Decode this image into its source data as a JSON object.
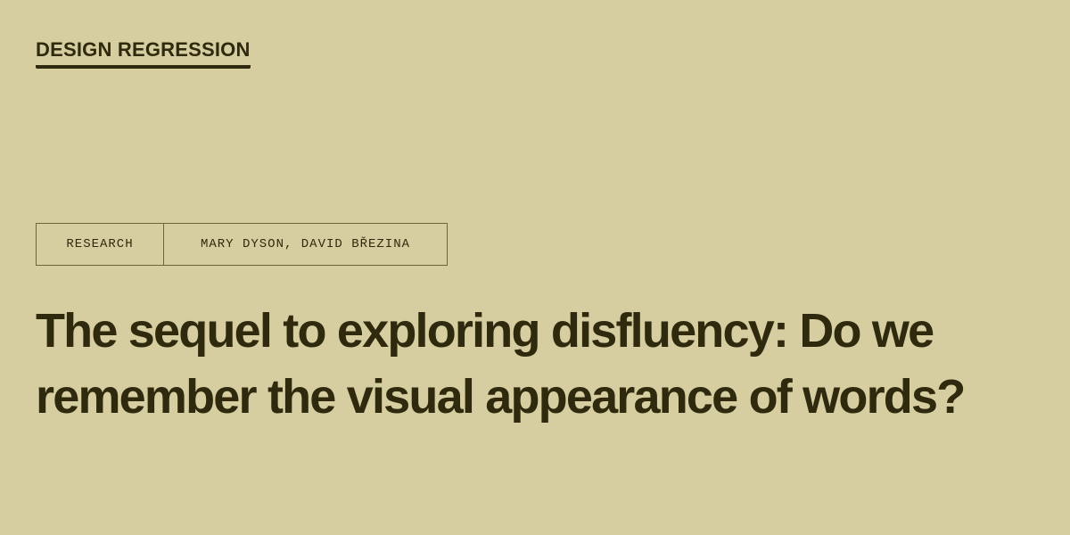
{
  "site": {
    "brand": "DESIGN REGRESSION"
  },
  "article": {
    "category": "RESEARCH",
    "authors": "MARY DYSON, DAVID BŘEZINA",
    "title": "The sequel to exploring disfluency: Do we remember the visual appearance of words?"
  },
  "colors": {
    "background": "#d6cda0",
    "text": "#2f2a0d",
    "border": "#6e6535"
  }
}
